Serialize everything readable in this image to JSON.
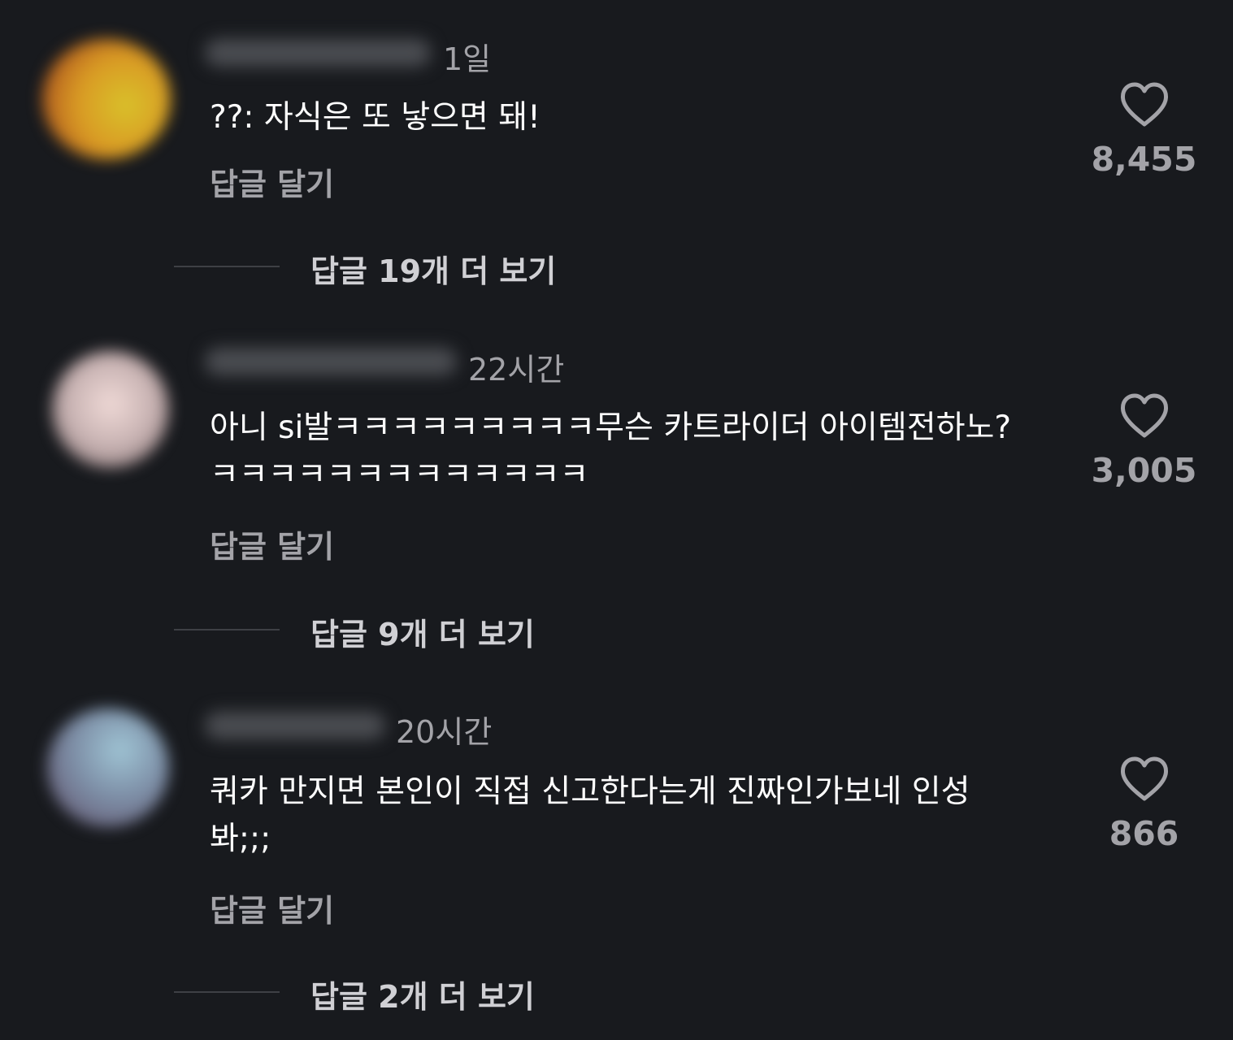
{
  "comments": [
    {
      "time": "1일",
      "text": "??: 자식은 또 낳으면 돼!",
      "reply_label": "답글 달기",
      "likes": "8,455",
      "more_replies": "답글 19개 더 보기"
    },
    {
      "time": "22시간",
      "text": "아니 si발ㅋㅋㅋㅋㅋㅋㅋㅋㅋ무슨 카트라이더 아이템전하노?ㅋㅋㅋㅋㅋㅋㅋㅋㅋㅋㅋㅋㅋ",
      "reply_label": "답글 달기",
      "likes": "3,005",
      "more_replies": "답글 9개 더 보기"
    },
    {
      "time": "20시간",
      "text": "쿼카 만지면 본인이 직접 신고한다는게 진짜인가보네 인성봐;;;",
      "reply_label": "답글 달기",
      "likes": "866",
      "more_replies": "답글 2개 더 보기"
    }
  ],
  "icons": {
    "like": "heart-outline-icon"
  },
  "colors": {
    "background": "#181a1e",
    "text": "#ffffff",
    "muted": "#a3a3a8"
  }
}
